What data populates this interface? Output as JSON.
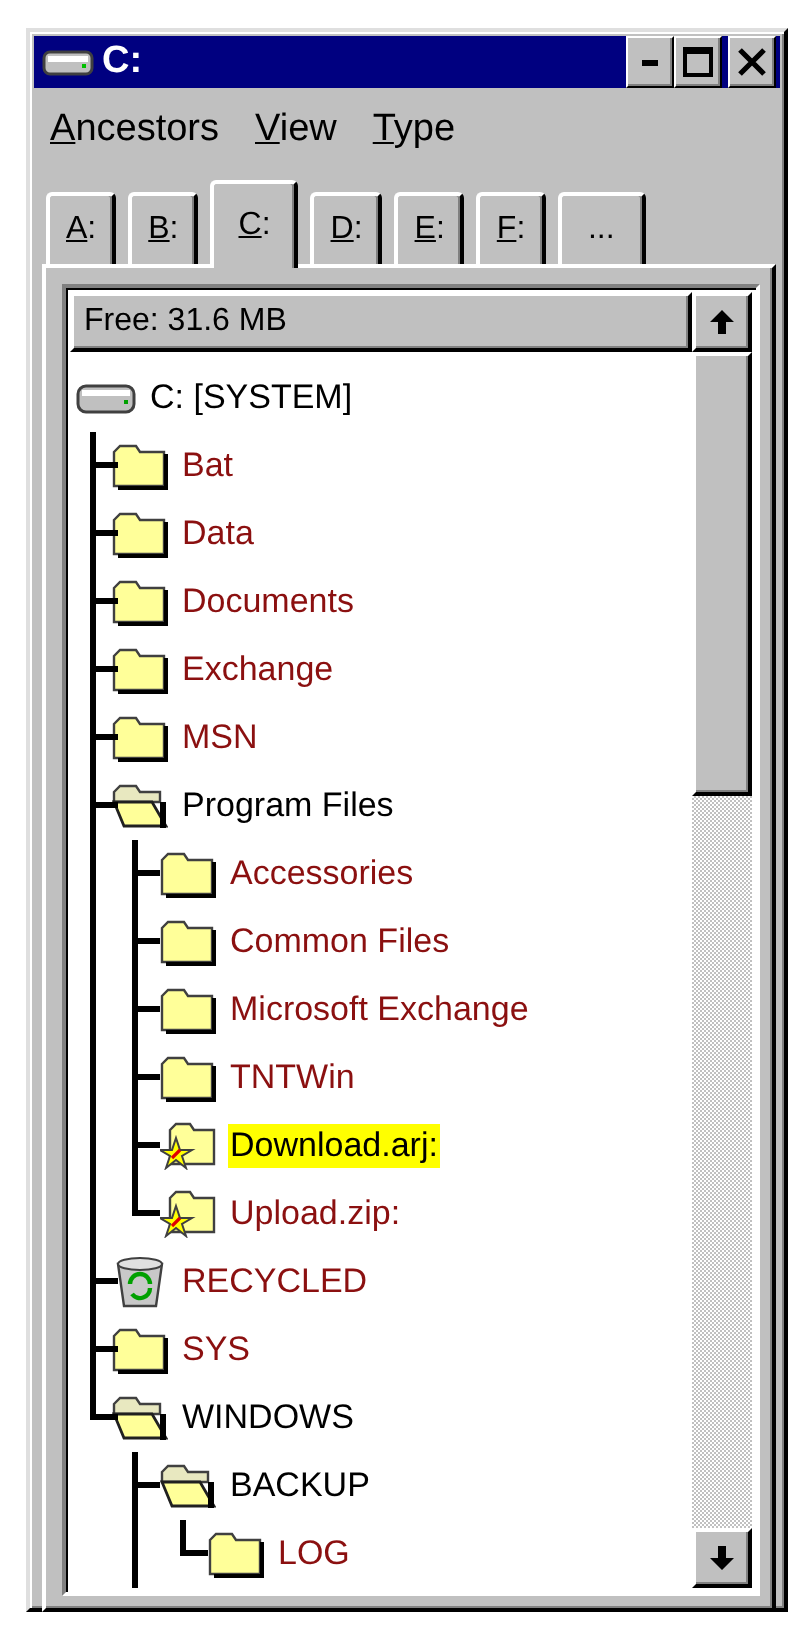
{
  "window": {
    "title": "C:"
  },
  "menu": [
    {
      "mnemonic": "A",
      "rest": "ncestors"
    },
    {
      "mnemonic": "V",
      "rest": "iew"
    },
    {
      "mnemonic": "T",
      "rest": "ype"
    }
  ],
  "tabs": [
    {
      "mnemonic": "A",
      "rest": ":",
      "selected": false
    },
    {
      "mnemonic": "B",
      "rest": ":",
      "selected": false
    },
    {
      "mnemonic": "C",
      "rest": ":",
      "selected": true
    },
    {
      "mnemonic": "D",
      "rest": ":",
      "selected": false
    },
    {
      "mnemonic": "E",
      "rest": ":",
      "selected": false
    },
    {
      "mnemonic": "F",
      "rest": ":",
      "selected": false
    },
    {
      "rest": "...",
      "selected": false
    }
  ],
  "free_space": "Free: 31.6 MB",
  "tree": [
    {
      "label": "C: [SYSTEM]",
      "kind": "drive",
      "expanded": true,
      "selected": false,
      "children": [
        {
          "label": "Bat",
          "kind": "folder",
          "expanded": false,
          "selected": false
        },
        {
          "label": "Data",
          "kind": "folder",
          "expanded": false,
          "selected": false
        },
        {
          "label": "Documents",
          "kind": "folder",
          "expanded": false,
          "selected": false
        },
        {
          "label": "Exchange",
          "kind": "folder",
          "expanded": false,
          "selected": false
        },
        {
          "label": "MSN",
          "kind": "folder",
          "expanded": false,
          "selected": false
        },
        {
          "label": "Program Files",
          "kind": "folder",
          "expanded": true,
          "selected": false,
          "children": [
            {
              "label": "Accessories",
              "kind": "folder",
              "expanded": false,
              "selected": false
            },
            {
              "label": "Common Files",
              "kind": "folder",
              "expanded": false,
              "selected": false
            },
            {
              "label": "Microsoft Exchange",
              "kind": "folder",
              "expanded": false,
              "selected": false
            },
            {
              "label": "TNTWin",
              "kind": "folder",
              "expanded": false,
              "selected": false
            },
            {
              "label": "Download.arj:",
              "kind": "archive",
              "selected": true
            },
            {
              "label": "Upload.zip:",
              "kind": "archive",
              "selected": false
            }
          ]
        },
        {
          "label": "RECYCLED",
          "kind": "recycle",
          "expanded": false,
          "selected": false
        },
        {
          "label": "SYS",
          "kind": "folder",
          "expanded": false,
          "selected": false
        },
        {
          "label": "WINDOWS",
          "kind": "folder",
          "expanded": true,
          "selected": false,
          "more_children": true,
          "children": [
            {
              "label": "BACKUP",
              "kind": "folder",
              "expanded": true,
              "selected": false,
              "children": [
                {
                  "label": "LOG",
                  "kind": "folder",
                  "expanded": false,
                  "selected": false
                }
              ]
            }
          ]
        }
      ]
    }
  ]
}
